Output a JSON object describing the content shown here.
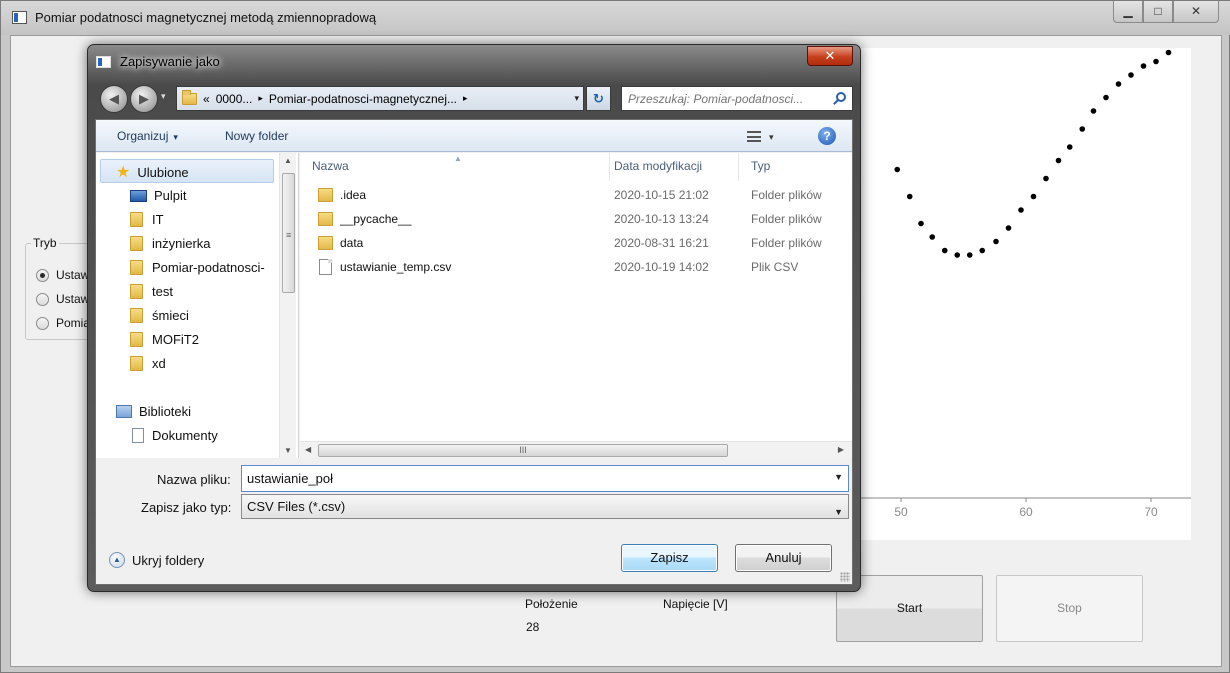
{
  "main_window": {
    "title": "Pomiar podatnosci magnetycznej metodą zmiennopradową",
    "controls": {
      "minimize": "▁",
      "maximize": "□",
      "close": "✕"
    },
    "tryb": {
      "title": "Tryb",
      "options": [
        {
          "label": "Ustaw",
          "selected": true
        },
        {
          "label": "Ustaw",
          "selected": false
        },
        {
          "label": "Pomia",
          "selected": false
        }
      ]
    },
    "chart": {
      "x_ticks": [
        "50",
        "60",
        "70"
      ]
    },
    "labels": {
      "polozenie": "Położenie",
      "napiecie": "Napięcie [V]",
      "polozenie_value": "28"
    },
    "buttons": {
      "start": "Start",
      "stop": "Stop"
    }
  },
  "chart_data": {
    "type": "scatter",
    "title": "",
    "xlabel": "",
    "ylabel": "",
    "x_ticks": [
      50,
      60,
      70
    ],
    "series": [
      {
        "x": [
          49.7,
          50.7,
          51.6,
          52.5,
          53.5,
          54.5,
          55.5,
          56.5,
          57.6,
          58.6,
          59.6,
          60.6,
          61.6,
          62.6,
          63.5,
          64.5,
          65.4,
          66.4,
          67.4,
          68.4,
          69.4,
          70.4,
          71.4
        ],
        "y": [
          0.73,
          0.67,
          0.61,
          0.58,
          0.55,
          0.54,
          0.54,
          0.55,
          0.57,
          0.6,
          0.64,
          0.67,
          0.71,
          0.75,
          0.78,
          0.82,
          0.86,
          0.89,
          0.92,
          0.94,
          0.96,
          0.97,
          0.99
        ]
      }
    ]
  },
  "dialog": {
    "title": "Zapisywanie jako",
    "close": "✕",
    "nav": {
      "back": "◀",
      "forward": "▶",
      "history": "▾"
    },
    "address": {
      "prefix": "«",
      "segments": [
        "0000...",
        "Pomiar-podatnosci-magnetycznej..."
      ],
      "separator": "▸",
      "dropdown": "▾"
    },
    "refresh": "↻",
    "search": {
      "placeholder": "Przeszukaj: Pomiar-podatnosci..."
    },
    "toolbar": {
      "organize": "Organizuj",
      "organize_caret": "▾",
      "new_folder": "Nowy folder",
      "views_caret": "▾",
      "help": "?"
    },
    "nav_pane": {
      "favorites": "Ulubione",
      "items": [
        "Pulpit",
        "IT",
        "inżynierka",
        "Pomiar-podatnosci-",
        "test",
        "śmieci",
        "MOFiT2",
        "xd"
      ],
      "libraries": "Biblioteki",
      "library_items": [
        "Dokumenty"
      ]
    },
    "columns": {
      "name": "Nazwa",
      "modified": "Data modyfikacji",
      "type": "Typ",
      "sort": "▲"
    },
    "files": [
      {
        "name": ".idea",
        "modified": "2020-10-15 21:02",
        "type": "Folder plików",
        "kind": "folder"
      },
      {
        "name": "__pycache__",
        "modified": "2020-10-13 13:24",
        "type": "Folder plików",
        "kind": "folder"
      },
      {
        "name": "data",
        "modified": "2020-08-31 16:21",
        "type": "Folder plików",
        "kind": "folder"
      },
      {
        "name": "ustawianie_temp.csv",
        "modified": "2020-10-19 14:02",
        "type": "Plik CSV",
        "kind": "file"
      }
    ],
    "scroll": {
      "up": "▲",
      "down": "▼",
      "left": "◀",
      "right": "▶",
      "grip": "≡",
      "hgrip": "III"
    },
    "file_name": {
      "label": "Nazwa pliku:",
      "value": "ustawianie_poł",
      "dropdown": "▼"
    },
    "file_type": {
      "label": "Zapisz jako typ:",
      "value": "CSV Files (*.csv)",
      "dropdown": "▼"
    },
    "hide_folders": {
      "label": "Ukryj foldery",
      "icon": "▲"
    },
    "save": "Zapisz",
    "cancel": "Anuluj"
  }
}
